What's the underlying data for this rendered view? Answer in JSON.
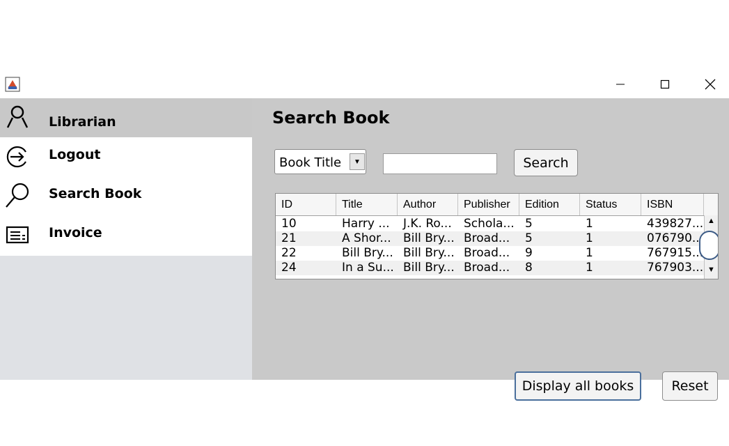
{
  "window": {
    "app_icon": "java-app-icon",
    "controls": {
      "minimize": "minimize-icon",
      "maximize": "maximize-icon",
      "close": "close-icon"
    }
  },
  "sidebar": {
    "user": {
      "label": "Librarian",
      "icon": "user-icon"
    },
    "items": [
      {
        "label": "Logout",
        "icon": "logout-icon"
      },
      {
        "label": "Search Book",
        "icon": "search-icon"
      },
      {
        "label": "Invoice",
        "icon": "invoice-icon"
      }
    ]
  },
  "main": {
    "title": "Search Book",
    "filter": {
      "selected": "Book Title"
    },
    "search_input": {
      "value": ""
    },
    "search_button": "Search",
    "display_all_button": "Display all books",
    "reset_button": "Reset"
  },
  "table": {
    "columns": [
      "ID",
      "Title",
      "Author",
      "Publisher",
      "Edition",
      "Status",
      "ISBN"
    ],
    "rows": [
      [
        "10",
        "Harry ...",
        "J.K. Ro...",
        "Schola...",
        "5",
        "1",
        "439827..."
      ],
      [
        "21",
        "A Shor...",
        "Bill Bry...",
        "Broad...",
        "5",
        "1",
        "076790..."
      ],
      [
        "22",
        "Bill Bry...",
        "Bill Bry...",
        "Broad...",
        "9",
        "1",
        "767915..."
      ],
      [
        "24",
        "In a Su...",
        "Bill Bry...",
        "Broad...",
        "8",
        "1",
        "767903..."
      ]
    ]
  }
}
